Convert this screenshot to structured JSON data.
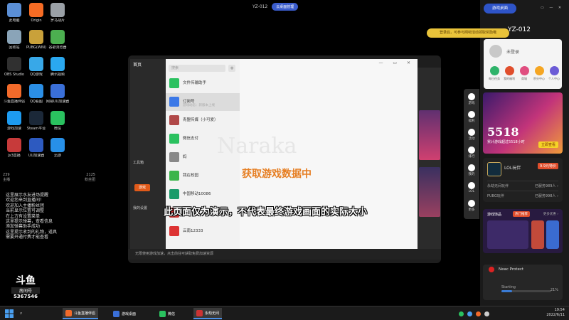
{
  "desktop": {
    "icons": [
      {
        "label": "此电脑",
        "color": "#5b8fd6"
      },
      {
        "label": "Origin",
        "color": "#f56b24"
      },
      {
        "label": "罗马战片",
        "color": "#9aa0a6"
      },
      {
        "label": "回收站",
        "color": "#8aa4b8"
      },
      {
        "label": "PUBG(WIN)",
        "color": "#c9a13a"
      },
      {
        "label": "谷歌浏览器",
        "color": "#4caf50"
      },
      {
        "label": "OBS Studio",
        "color": "#303030"
      },
      {
        "label": "QQ游戏",
        "color": "#38a8e8"
      },
      {
        "label": "腾讯视频",
        "color": "#2aa8f0"
      },
      {
        "label": "斗鱼直播伴侣",
        "color": "#f26a2a"
      },
      {
        "label": "QQ看图",
        "color": "#2b8fe6"
      },
      {
        "label": "网易UU加速器",
        "color": "#3a6fd8"
      },
      {
        "label": "游戏加速",
        "color": "#1d9bf0"
      },
      {
        "label": "Steam平台",
        "color": "#1b2838"
      },
      {
        "label": "微信",
        "color": "#2ac15f"
      },
      {
        "label": "Jx3直播",
        "color": "#c73a3a"
      },
      {
        "label": "UU加速器",
        "color": "#2d5ac0"
      },
      {
        "label": "迅游",
        "color": "#2790e8"
      }
    ]
  },
  "top": {
    "monitor_label": "YZ-012",
    "pill_label": "云桌面管理"
  },
  "stream": {
    "stats": [
      {
        "a": "239",
        "b": "2125"
      },
      {
        "a": "主播",
        "b": "粉丝团"
      }
    ],
    "chat": [
      "这里展示水友进场提醒",
      "欢迎您来到直播间！",
      "欢迎加入主播粉丝团",
      "当前显示位置可调整",
      "在上方有设置菜单",
      "这里提示弹幕，查看信息",
      "添加弹幕助手成功",
      "这里提示收到的礼物，道具",
      "需要开通付费才能查看"
    ],
    "brand": "斗鱼",
    "room_label": "房间号",
    "room_number": "5367546"
  },
  "wechat": {
    "side_title": "首页",
    "side_items": [
      "工具箱",
      "我的设置"
    ],
    "side_button": "游戏",
    "search_placeholder": "搜索",
    "plus": "+",
    "chats": [
      {
        "name": "文件传输助手",
        "sub": "",
        "color": "#2ac15f"
      },
      {
        "name": "订阅号",
        "sub": "游戏动态：新版本上线",
        "color": "#3b78e7"
      },
      {
        "name": "青盟传媒（小可爱）",
        "sub": "",
        "color": "#b04848"
      },
      {
        "name": "微信支付",
        "sub": "",
        "color": "#2ac15f"
      },
      {
        "name": "妈",
        "sub": "",
        "color": "#888"
      },
      {
        "name": "我在校园",
        "sub": "",
        "color": "#3ab54a"
      },
      {
        "name": "中国移动10086",
        "sub": "",
        "color": "#1a9b6a"
      },
      {
        "name": "",
        "sub": "",
        "color": "#c33"
      },
      {
        "name": "云南12333",
        "sub": "",
        "color": "#d33"
      }
    ],
    "watermark": "Naraka",
    "main_title": "获取游戏数据中",
    "bottom_note": "无限使用游戏加速，点击前往可获取免费加速资源"
  },
  "subtitle": "此页面仅为演示，不代表最终游戏画面的实际大小",
  "rpanel": {
    "top_button": "游戏桌面",
    "window_controls": "▭ — ✕",
    "station": "YZ-012",
    "notice": "登录后，可参与网吧活动领取奖励哦",
    "login_text": "未登录",
    "actions": [
      {
        "label": "每日任务",
        "color": "#2fb36a"
      },
      {
        "label": "我的福利",
        "color": "#e04e2c"
      },
      {
        "label": "商城",
        "color": "#e04e80"
      },
      {
        "label": "积分中心",
        "color": "#f5a623"
      },
      {
        "label": "个人中心",
        "color": "#6b5bd6"
      }
    ],
    "nav": [
      "游戏",
      "福利",
      "活动",
      "排行",
      "我的",
      "LOL",
      "更多"
    ],
    "banner_num": "5518",
    "banner_sub": "累计游戏超过5518小时",
    "banner_tag": "立即查看",
    "lol_name": "LOL玩伴",
    "lol_badge": "9.9元特价",
    "lol_rows": [
      {
        "k": "永劫无间玩伴",
        "v": "已服务989人 ›"
      },
      {
        "k": "PUBG玩伴",
        "v": "已服务998人 ›"
      }
    ],
    "store_title": "游戏饰品",
    "store_badge": "热门推荐",
    "store_more": "更多优惠 ›",
    "neac_title": "Neac Protect",
    "neac_status": "Starting",
    "neac_progress": 0.21,
    "neac_pct": "21%"
  },
  "taskbar": {
    "apps": [
      {
        "label": "斗鱼直播伴侣",
        "color": "#f26a2a",
        "active": true
      },
      {
        "label": "游戏桌面",
        "color": "#3a6fd8",
        "active": false
      },
      {
        "label": "微信",
        "color": "#2ac15f",
        "active": false
      },
      {
        "label": "永劫无间",
        "color": "#c33",
        "active": true
      }
    ],
    "time": "19:54",
    "date": "2022/6/11"
  }
}
